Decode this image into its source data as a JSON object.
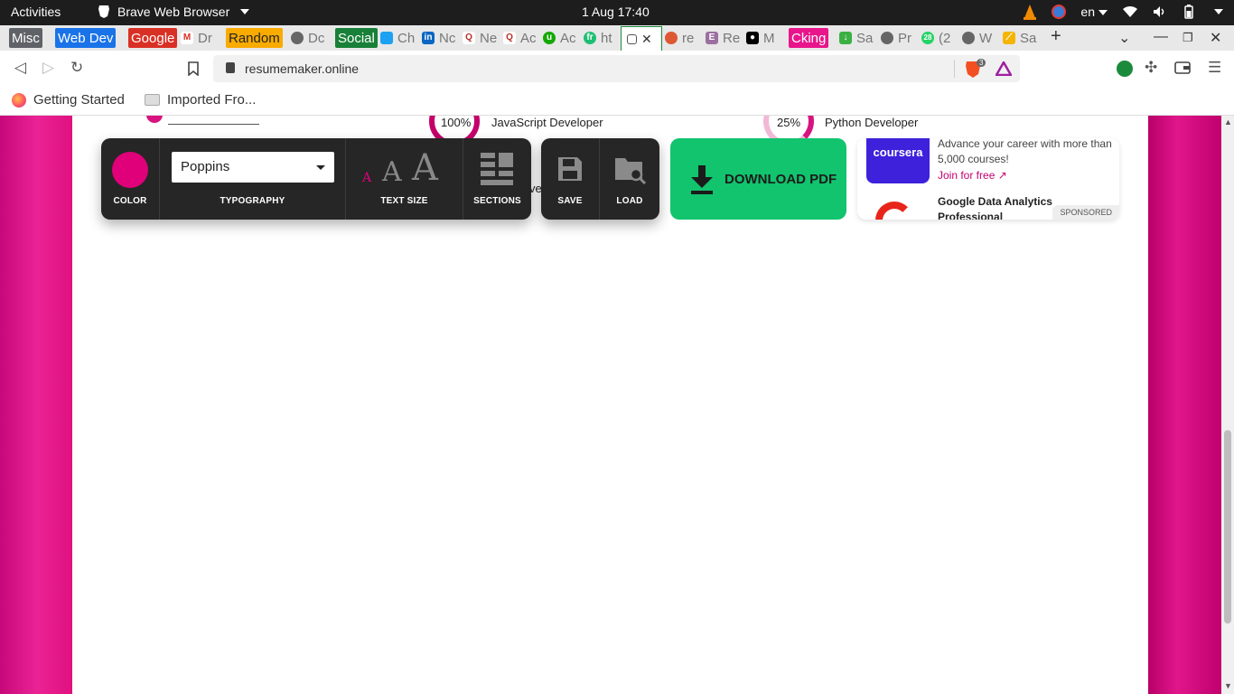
{
  "system_bar": {
    "activities": "Activities",
    "app_name": "Brave Web Browser",
    "clock": "1 Aug  17:40",
    "language": "en"
  },
  "tabs": {
    "groups": [
      {
        "label": "Misc",
        "color": "#5f6368"
      },
      {
        "label": "Web Dev",
        "color": "#1a73e8"
      },
      {
        "label": "Google",
        "color": "#d93025"
      },
      {
        "label": "Random",
        "color": "#f9ab00"
      },
      {
        "label": "Social",
        "color": "#188038"
      },
      {
        "label": "Cking",
        "color": "#e8158b"
      }
    ],
    "items": [
      {
        "label": "Dr"
      },
      {
        "label": "Dc"
      },
      {
        "label": "Ch"
      },
      {
        "label": "Nc"
      },
      {
        "label": "Ne"
      },
      {
        "label": "Ac"
      },
      {
        "label": "Ac"
      },
      {
        "label": "ht"
      },
      {
        "label": "re"
      },
      {
        "label": "Re"
      },
      {
        "label": "M"
      },
      {
        "label": "Sa"
      },
      {
        "label": "Pr"
      },
      {
        "label": "(2"
      },
      {
        "label": "W"
      },
      {
        "label": "Sa"
      }
    ],
    "new_tab": "+"
  },
  "address_bar": {
    "url": "resumemaker.online",
    "shield_count": "3"
  },
  "bookmarks": {
    "items": [
      {
        "label": "Getting Started"
      },
      {
        "label": "Imported Fro..."
      }
    ]
  },
  "resume": {
    "skills": [
      {
        "percent": "100%",
        "name": "JavaScript Developer"
      },
      {
        "percent": "25%",
        "name": "Python Developer"
      }
    ],
    "partial_word": "ve"
  },
  "toolbar": {
    "color_label": "COLOR",
    "typography_label": "TYPOGRAPHY",
    "font_value": "Poppins",
    "text_size_label": "TEXT SIZE",
    "sections_label": "SECTIONS",
    "save_label": "SAVE",
    "load_label": "LOAD",
    "download_label": "DOWNLOAD PDF",
    "accent_color": "#e0007a",
    "download_color": "#11c46d"
  },
  "ad": {
    "brand": "coursera",
    "text1": "Advance your career with more than 5,000 courses!",
    "cta": "Join for free ↗",
    "title2": "Google Data Analytics Professional Certificate",
    "sponsored": "SPONSORED"
  }
}
